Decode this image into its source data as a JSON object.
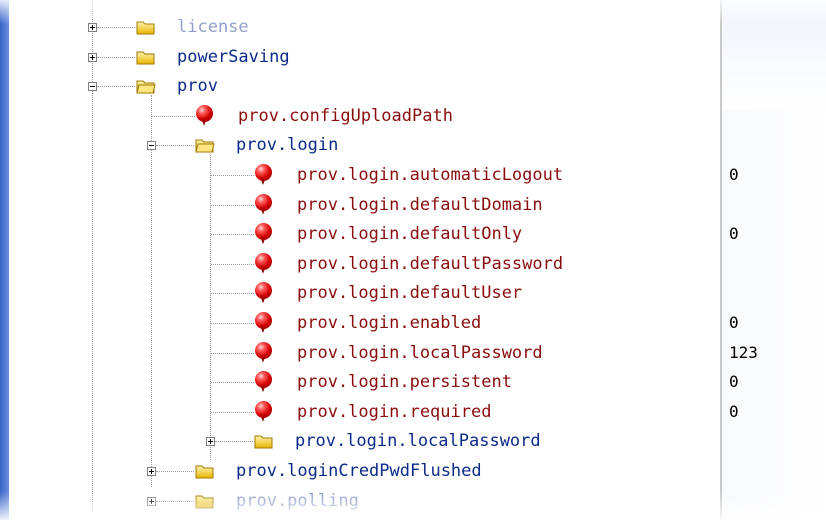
{
  "tree": {
    "nodes": [
      {
        "label": "license",
        "kind": "folder",
        "expander": "plus"
      },
      {
        "label": "powerSaving",
        "kind": "folder",
        "expander": "plus"
      },
      {
        "label": "prov",
        "kind": "folder",
        "expander": "minus"
      },
      {
        "label": "prov.configUploadPath",
        "kind": "param"
      },
      {
        "label": "prov.login",
        "kind": "folder",
        "expander": "minus"
      },
      {
        "label": "prov.login.automaticLogout",
        "kind": "param",
        "value": "0"
      },
      {
        "label": "prov.login.defaultDomain",
        "kind": "param",
        "value": ""
      },
      {
        "label": "prov.login.defaultOnly",
        "kind": "param",
        "value": "0"
      },
      {
        "label": "prov.login.defaultPassword",
        "kind": "param",
        "value": ""
      },
      {
        "label": "prov.login.defaultUser",
        "kind": "param",
        "value": ""
      },
      {
        "label": "prov.login.enabled",
        "kind": "param",
        "value": "0"
      },
      {
        "label": "prov.login.localPassword",
        "kind": "param",
        "value": "123"
      },
      {
        "label": "prov.login.persistent",
        "kind": "param",
        "value": "0"
      },
      {
        "label": "prov.login.required",
        "kind": "param",
        "value": "0"
      },
      {
        "label": "prov.login.localPassword",
        "kind": "folder",
        "expander": "plus"
      },
      {
        "label": "prov.loginCredPwdFlushed",
        "kind": "folder",
        "expander": "plus"
      },
      {
        "label": "prov.polling",
        "kind": "folder",
        "expander": "plus"
      }
    ]
  },
  "colors": {
    "folder_label": "#0b2a8a",
    "param_label": "#8a0c0c",
    "accent_bar": "#3a63c8"
  }
}
